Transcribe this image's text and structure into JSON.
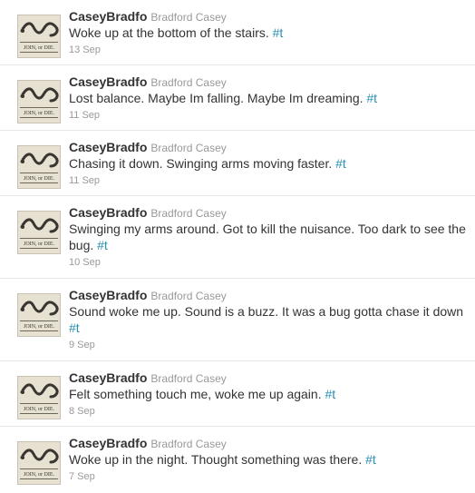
{
  "feed": {
    "tweets": [
      {
        "username": "CaseyBradfo",
        "fullname": "Bradford Casey",
        "text": "Woke up at the bottom of the stairs.",
        "link": "#t",
        "date": "13 Sep"
      },
      {
        "username": "CaseyBradfo",
        "fullname": "Bradford Casey",
        "text": "Lost balance. Maybe Im falling. Maybe Im dreaming.",
        "link": "#t",
        "date": "11 Sep"
      },
      {
        "username": "CaseyBradfo",
        "fullname": "Bradford Casey",
        "text": "Chasing it down. Swinging arms moving faster.",
        "link": "#t",
        "date": "11 Sep"
      },
      {
        "username": "CaseyBradfo",
        "fullname": "Bradford Casey",
        "text": "Swinging my arms around. Got to kill the nuisance. Too dark to see the bug.",
        "link": "#t",
        "date": "10 Sep"
      },
      {
        "username": "CaseyBradfo",
        "fullname": "Bradford Casey",
        "text": "Sound woke me up. Sound is a buzz. It was a bug gotta chase it down",
        "link": "#t",
        "date": "9 Sep"
      },
      {
        "username": "CaseyBradfo",
        "fullname": "Bradford Casey",
        "text": "Felt something touch me, woke me up again.",
        "link": "#t",
        "date": "8 Sep"
      },
      {
        "username": "CaseyBradfo",
        "fullname": "Bradford Casey",
        "text": "Woke up in the night. Thought something was there.",
        "link": "#t",
        "date": "7 Sep"
      }
    ]
  },
  "avatar": {
    "image": "join-or-die-snake-avatar",
    "caption": "JOIN, or DIE."
  },
  "colors": {
    "link": "#2b8fb3",
    "meta": "#999999",
    "text": "#333333",
    "divider": "#e8e8e8"
  }
}
